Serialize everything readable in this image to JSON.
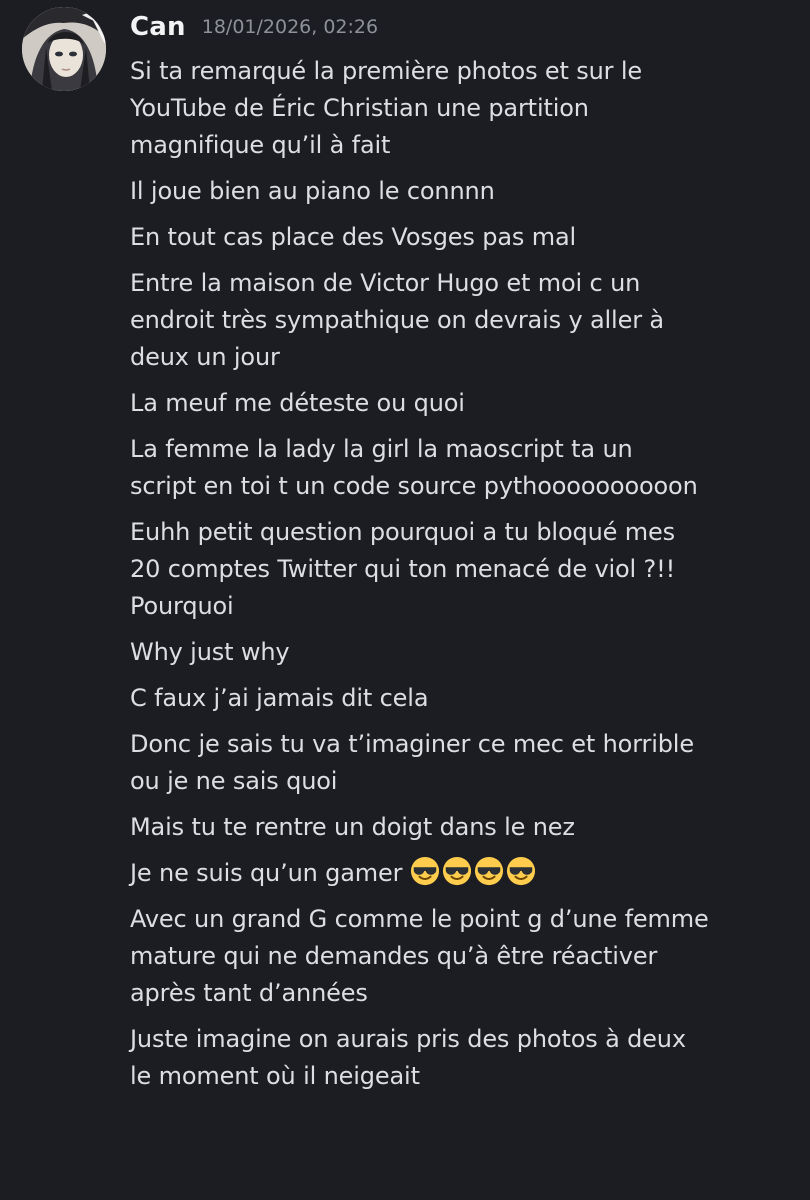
{
  "message_group": {
    "author": "Can",
    "timestamp": "18/01/2026, 02:26",
    "avatar_icon": "user-avatar"
  },
  "messages": [
    {
      "lines": [
        "Si ta remarqué la première photos et sur le",
        "YouTube de Éric Christian une partition",
        "magnifique qu’il à fait"
      ]
    },
    {
      "lines": [
        "Il joue bien au piano le connnn"
      ]
    },
    {
      "lines": [
        "En tout cas place des Vosges pas mal"
      ]
    },
    {
      "lines": [
        "Entre la maison de Victor Hugo et moi c un",
        "endroit très sympathique on devrais y aller à",
        "deux un jour"
      ]
    },
    {
      "lines": [
        "La meuf me déteste ou quoi"
      ]
    },
    {
      "lines": [
        "La femme la lady la girl la maoscript ta un",
        "script en toi t un code source pythoooooooooon"
      ]
    },
    {
      "lines": [
        "Euhh petit question pourquoi a tu bloqué mes",
        "20 comptes Twitter qui ton menacé de viol ?!!",
        "Pourquoi"
      ]
    },
    {
      "lines": [
        "Why just why"
      ]
    },
    {
      "lines": [
        "C faux j’ai jamais dit cela"
      ]
    },
    {
      "lines": [
        "Donc je sais tu va t’imaginer ce mec et horrible",
        "ou je ne sais quoi"
      ]
    },
    {
      "lines": [
        "Mais tu te rentre un doigt dans le nez"
      ]
    },
    {
      "lines": [
        "Je ne suis qu’un gamer"
      ],
      "emoji_count": 4,
      "emoji": "smiling-face-with-sunglasses"
    },
    {
      "lines": [
        "Avec un grand G comme le point g d’une femme",
        "mature qui ne demandes qu’à être réactiver",
        "après tant d’années"
      ]
    },
    {
      "lines": [
        "Juste imagine on aurais pris des photos à deux",
        "le moment où il neigeait"
      ]
    }
  ],
  "colors": {
    "background": "#1c1d22",
    "text": "#dcdee3",
    "author": "#f2f3f5",
    "timestamp": "#8d9199"
  }
}
